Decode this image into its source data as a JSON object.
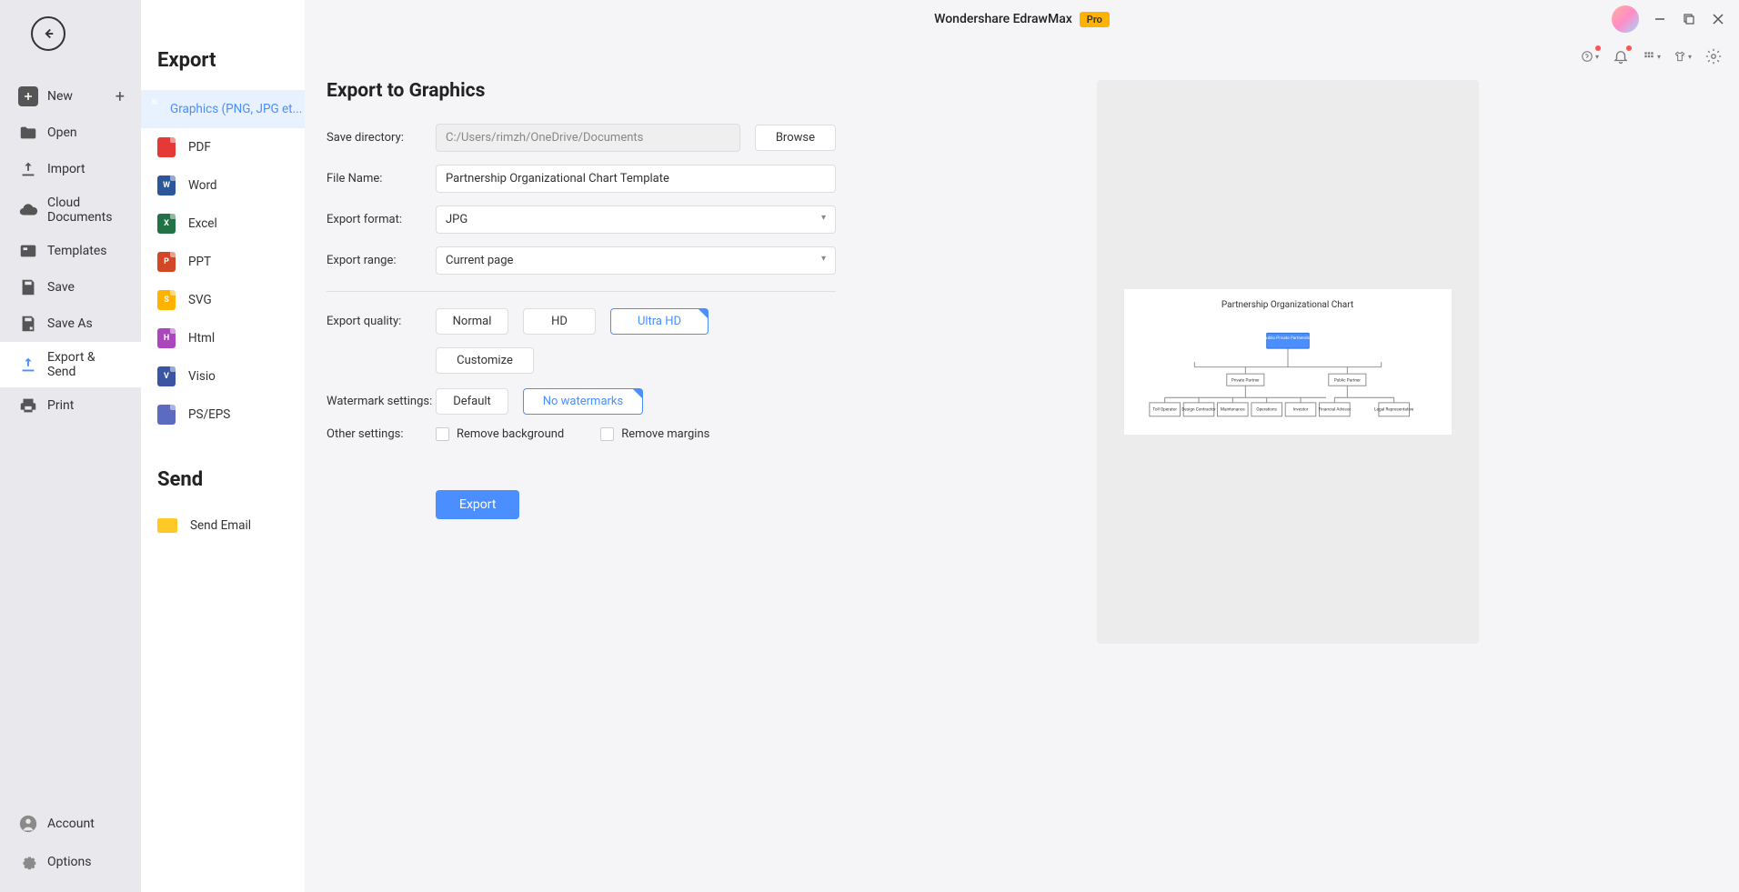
{
  "app": {
    "title": "Wondershare EdrawMax",
    "badge": "Pro"
  },
  "nav": {
    "items": [
      {
        "label": "New"
      },
      {
        "label": "Open"
      },
      {
        "label": "Import"
      },
      {
        "label": "Cloud Documents"
      },
      {
        "label": "Templates"
      },
      {
        "label": "Save"
      },
      {
        "label": "Save As"
      },
      {
        "label": "Export & Send"
      },
      {
        "label": "Print"
      }
    ],
    "footer": {
      "account": "Account",
      "options": "Options"
    }
  },
  "export": {
    "section_export": "Export",
    "section_send": "Send",
    "types": [
      {
        "label": "Graphics (PNG, JPG et...",
        "kind": "img",
        "selected": true
      },
      {
        "label": "PDF",
        "kind": "pdf"
      },
      {
        "label": "Word",
        "kind": "word"
      },
      {
        "label": "Excel",
        "kind": "excel"
      },
      {
        "label": "PPT",
        "kind": "ppt"
      },
      {
        "label": "SVG",
        "kind": "svg"
      },
      {
        "label": "Html",
        "kind": "html"
      },
      {
        "label": "Visio",
        "kind": "visio"
      },
      {
        "label": "PS/EPS",
        "kind": "ps"
      }
    ],
    "send_items": [
      {
        "label": "Send Email",
        "kind": "email"
      }
    ]
  },
  "form": {
    "title": "Export to Graphics",
    "save_dir_label": "Save directory:",
    "save_dir_value": "C:/Users/rimzh/OneDrive/Documents",
    "browse": "Browse",
    "file_name_label": "File Name:",
    "file_name_value": "Partnership Organizational Chart Template",
    "format_label": "Export format:",
    "format_value": "JPG",
    "range_label": "Export range:",
    "range_value": "Current page",
    "quality_label": "Export quality:",
    "quality_options": {
      "normal": "Normal",
      "hd": "HD",
      "ultra": "Ultra HD",
      "custom": "Customize"
    },
    "watermark_label": "Watermark settings:",
    "watermark_options": {
      "default": "Default",
      "none": "No watermarks"
    },
    "other_label": "Other settings:",
    "remove_bg": "Remove background",
    "remove_margins": "Remove margins",
    "export_btn": "Export"
  },
  "preview": {
    "chart_title": "Partnership Organizational Chart",
    "top_node": "Public-Private Partnership",
    "mid_nodes": [
      "Private Partner",
      "Public Partner"
    ],
    "leaf_nodes": [
      "Toll Operator",
      "Design Contractor",
      "Maintenance",
      "Operations",
      "Investor",
      "Financial Advisor",
      "Legal Representative"
    ]
  }
}
